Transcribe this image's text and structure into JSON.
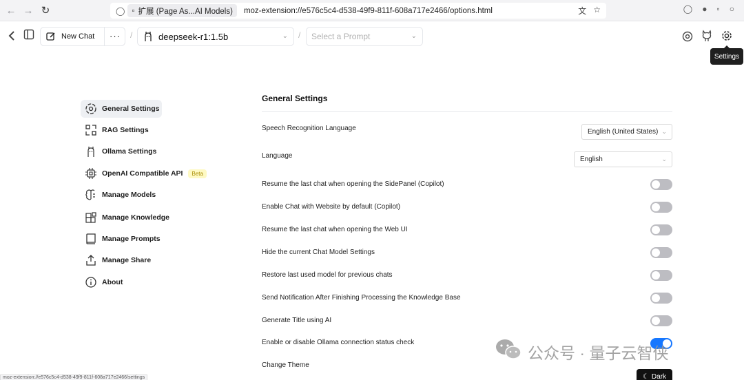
{
  "browser": {
    "tab_chip": "扩展 (Page As...AI Models)",
    "url": "moz-extension://e576c5c4-d538-49f9-811f-608a717e2466/options.html",
    "status_url": "moz-extension://e576c5c4-d538-49f9-811f-608a717e2466/settings"
  },
  "header": {
    "new_chat": "New Chat",
    "more": "···",
    "model": "deepseek-r1:1.5b",
    "prompt_placeholder": "Select a Prompt",
    "tooltip": "Settings"
  },
  "sidebar": {
    "items": [
      {
        "label": "General Settings",
        "icon": "settings-cog-icon"
      },
      {
        "label": "RAG Settings",
        "icon": "rag-icon"
      },
      {
        "label": "Ollama Settings",
        "icon": "ollama-icon"
      },
      {
        "label": "OpenAI Compatible API",
        "icon": "chip-icon",
        "badge": "Beta"
      },
      {
        "label": "Manage Models",
        "icon": "brain-icon"
      },
      {
        "label": "Manage Knowledge",
        "icon": "blocks-icon"
      },
      {
        "label": "Manage Prompts",
        "icon": "book-icon"
      },
      {
        "label": "Manage Share",
        "icon": "share-icon"
      },
      {
        "label": "About",
        "icon": "info-icon"
      }
    ]
  },
  "main": {
    "title": "General Settings",
    "speech_label": "Speech Recognition Language",
    "speech_value": "English (United States)",
    "language_label": "Language",
    "language_value": "English",
    "toggles": [
      {
        "label": "Resume the last chat when opening the SidePanel (Copilot)",
        "on": false
      },
      {
        "label": "Enable Chat with Website by default (Copilot)",
        "on": false
      },
      {
        "label": "Resume the last chat when opening the Web UI",
        "on": false
      },
      {
        "label": "Hide the current Chat Model Settings",
        "on": false
      },
      {
        "label": "Restore last used model for previous chats",
        "on": false
      },
      {
        "label": "Send Notification After Finishing Processing the Knowledge Base",
        "on": false
      },
      {
        "label": "Generate Title using AI",
        "on": false
      },
      {
        "label": "Enable or disable Ollama connection status check",
        "on": true
      }
    ],
    "theme_label": "Change Theme",
    "theme_button": "Dark"
  },
  "watermark": "公众号 · 量子云智侠"
}
